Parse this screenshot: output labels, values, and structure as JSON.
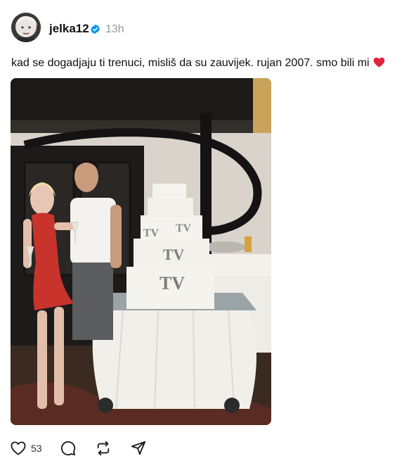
{
  "post": {
    "author": {
      "username": "jelka12",
      "verified": true,
      "avatar_icon": "avatar-icon"
    },
    "time": "13h",
    "caption": "kad se dogadjaju ti trenuci, mislis da su zauvijek. rujan 2007. smo bili mi",
    "caption_text": "kad se dogadjaju ti trenuci, misliš da su zauvijek. rujan 2007. smo bili mi",
    "caption_emoji": "red-heart-icon",
    "photo": {
      "description_icon": "photo-image",
      "cake_lettering": "TV"
    },
    "actions": {
      "like_count": "53",
      "like_icon": "heart-outline-icon",
      "reply_icon": "comment-bubble-icon",
      "repost_icon": "repost-icon",
      "share_icon": "send-icon"
    }
  },
  "colors": {
    "text": "#101010",
    "muted": "#9a9a9a",
    "verified_blue": "#0095f6",
    "heart_red": "#e0243a"
  }
}
